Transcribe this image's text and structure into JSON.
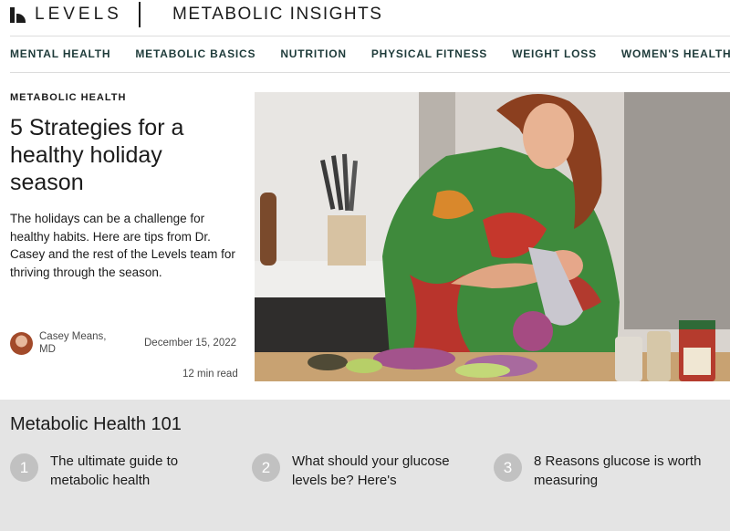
{
  "header": {
    "logo_text": "LEVELS",
    "section_title": "METABOLIC INSIGHTS"
  },
  "nav": {
    "items": [
      "MENTAL HEALTH",
      "METABOLIC BASICS",
      "NUTRITION",
      "PHYSICAL FITNESS",
      "WEIGHT LOSS",
      "WOMEN'S HEALTH"
    ]
  },
  "article": {
    "category": "METABOLIC HEALTH",
    "title": "5 Strategies for a healthy holiday season",
    "dek": "The holidays can be a challenge for healthy habits. Here are tips from Dr. Casey and the rest of the Levels team for thriving through the season.",
    "author": "Casey Means, MD",
    "date": "December 15, 2022",
    "read_time": "12 min read"
  },
  "metabolic_101": {
    "title": "Metabolic Health 101",
    "items": [
      {
        "number": "1",
        "text": "The ultimate guide to metabolic health"
      },
      {
        "number": "2",
        "text": "What should your glucose levels be? Here's"
      },
      {
        "number": "3",
        "text": "8 Reasons glucose is worth measuring"
      }
    ]
  },
  "colors": {
    "nav_text": "#1e3b3a",
    "strip_background": "#e4e4e4",
    "number_badge": "#c1c1c1"
  }
}
